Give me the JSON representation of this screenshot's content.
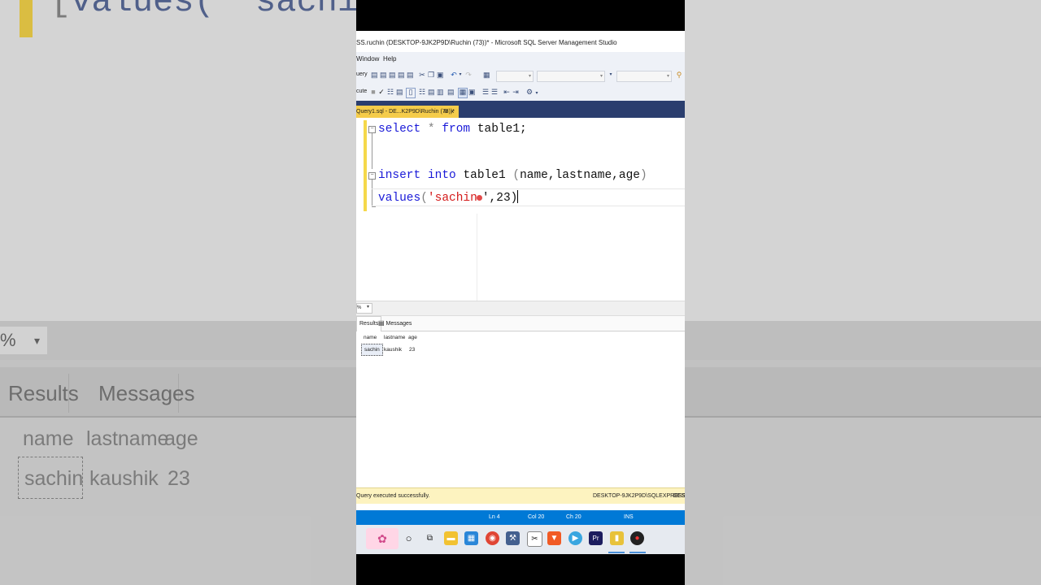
{
  "window": {
    "title": "SS.ruchin (DESKTOP-9JK2P9D\\Ruchin (73))* - Microsoft SQL Server Management Studio",
    "menu": [
      "Window",
      "Help"
    ],
    "toolbar_left_1": "uery",
    "toolbar_left_2": "cute"
  },
  "tab": {
    "label": "Query1.sql - DE...K2P9D\\Ruchin (73))*",
    "pin": "⊕",
    "close": "×"
  },
  "editor": {
    "line1": {
      "kw1": "select",
      "op": "*",
      "kw2": "from",
      "rest": "table1;"
    },
    "line3": {
      "kw1": "insert",
      "kw2": "into",
      "table": "table1",
      "open": "(",
      "cols": "name,lastname,age",
      "close": ")"
    },
    "line4": {
      "kw": "values",
      "open": "(",
      "str": "'sachin",
      "after": "',23)"
    }
  },
  "zoom": {
    "value": "%",
    "arrow": "▾"
  },
  "results": {
    "tabs": [
      "Results",
      "Messages"
    ],
    "columns": [
      "name",
      "lastname",
      "age"
    ],
    "rows": [
      [
        "sachin",
        "kaushik",
        "23"
      ]
    ]
  },
  "status": {
    "message": "Query executed successfully.",
    "server": "DESKTOP-9JK2P9D\\SQLEXPRESS ...",
    "extra": "DESK"
  },
  "position_bar": {
    "ln": "Ln 4",
    "col": "Col 20",
    "ch": "Ch 20",
    "mode": "INS"
  },
  "background_zoom": {
    "code": "values( 'sachin",
    "zoom": "%",
    "tabs": [
      "Results",
      "Messages"
    ],
    "columns": [
      "name",
      "lastname",
      "age"
    ],
    "row": [
      "sachin",
      "kaushik",
      "23"
    ]
  },
  "colors": {
    "keyword": "#1a1ad8",
    "string": "#d41a1a",
    "tab_active": "#f5cc4a",
    "tabstrip": "#2b3e6e",
    "statusbar_blue": "#0079d6",
    "status_yellow": "#fdf3c0"
  }
}
